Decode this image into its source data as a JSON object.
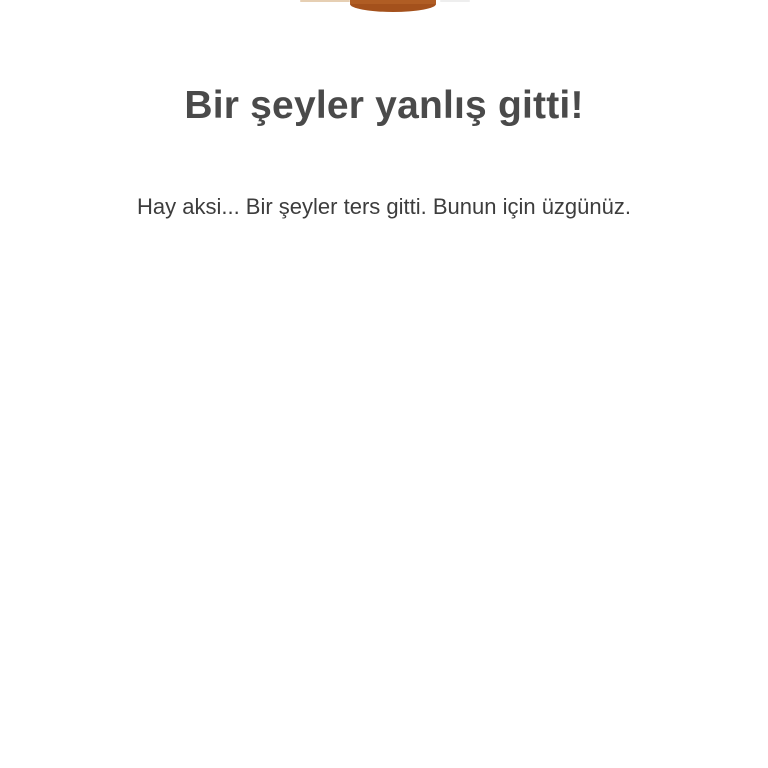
{
  "error_page": {
    "illustration_icon": "broken-pot-icon",
    "title": "Bir şeyler yanlış gitti!",
    "message": "Hay aksi... Bir şeyler ters gitti. Bunun için üzgünüz."
  },
  "colors": {
    "background": "#ffffff",
    "text": "#4a4a4a",
    "illustration_brown": "#a4511c",
    "illustration_light": "#d9b48a"
  }
}
